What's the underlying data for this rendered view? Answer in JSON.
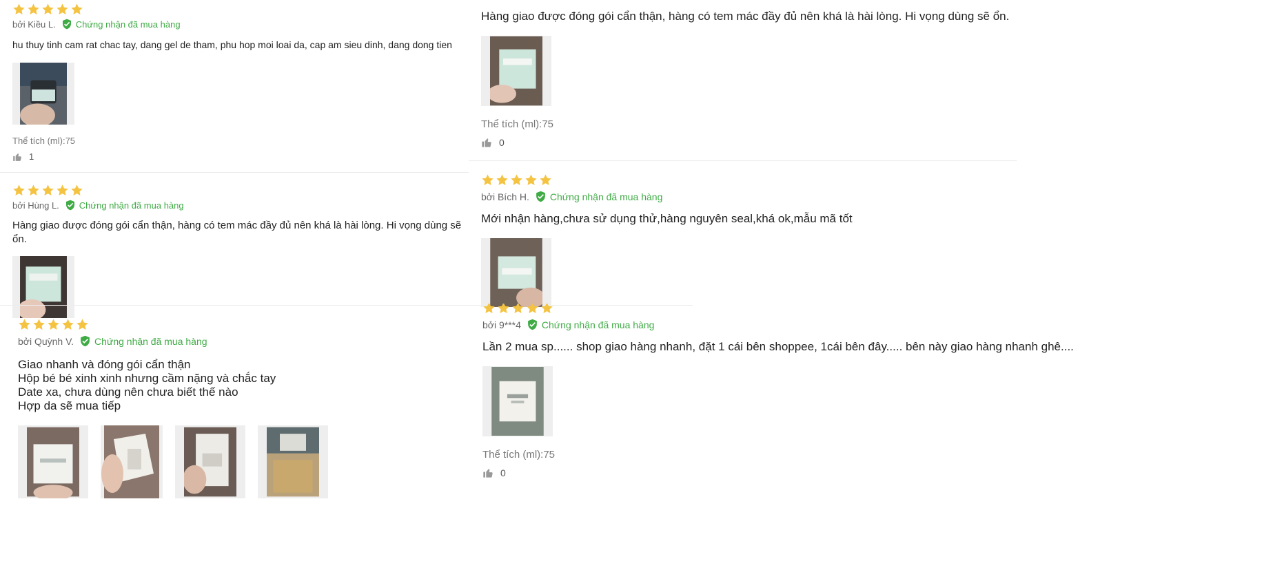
{
  "colors": {
    "star": "#f5c342",
    "verified": "#3fab45",
    "photo_bg": "#eeeeee"
  },
  "reviews": [
    {
      "author": "bởi Kiều L.",
      "verified": "Chứng nhận đã mua hàng",
      "rating": 5,
      "content": "hu thuy tinh cam rat chac tay, dang gel de tham, phu hop moi loai da, cap am sieu dinh, dang dong tien",
      "variant": "Thể tích (ml):75",
      "likes": "1"
    },
    {
      "content": "Hàng giao được đóng gói cẩn thận, hàng có tem mác đầy đủ nên khá là hài lòng. Hi vọng dùng sẽ ổn.",
      "variant": "Thể tích (ml):75",
      "likes": "0"
    },
    {
      "author": "bởi Hùng L.",
      "verified": "Chứng nhận đã mua hàng",
      "rating": 5,
      "content": "Hàng giao được đóng gói cẩn thận, hàng có tem mác đầy đủ nên khá là hài lòng. Hi vọng dùng sẽ ổn."
    },
    {
      "author": "bởi Bích H.",
      "verified": "Chứng nhận đã mua hàng",
      "rating": 5,
      "content": "Mới nhận hàng,chưa sử dụng thử,hàng nguyên seal,khá ok,mẫu mã tốt"
    },
    {
      "author": "bởi Quỳnh V.",
      "verified": "Chứng nhận đã mua hàng",
      "rating": 5,
      "content_lines": [
        "Giao nhanh và đóng gói cẩn thận",
        "Hộp bé bé xinh xinh nhưng cầm nặng và chắc tay",
        "Date xa, chưa dùng nên chưa biết thế nào",
        "Hợp da sẽ mua tiếp"
      ]
    },
    {
      "author": "bởi 9***4",
      "verified": "Chứng nhận đã mua hàng",
      "rating": 5,
      "content": "Lần 2 mua sp...... shop giao hàng nhanh, đặt 1 cái bên shoppee, 1cái bên đây..... bên này giao hàng nhanh ghê....",
      "variant": "Thể tích (ml):75",
      "likes": "0"
    }
  ]
}
